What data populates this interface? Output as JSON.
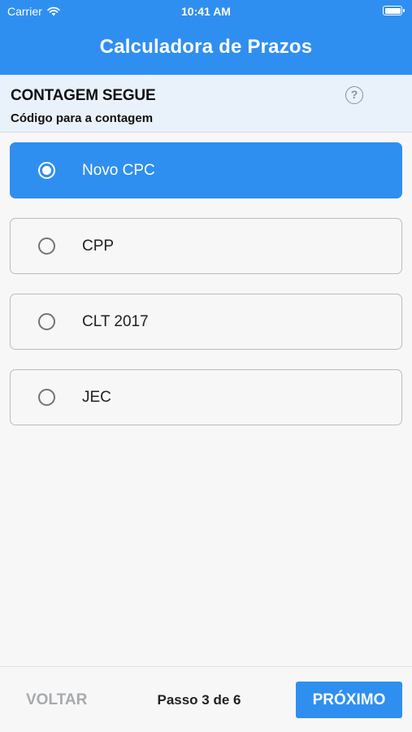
{
  "status_bar": {
    "carrier": "Carrier",
    "time": "10:41 AM"
  },
  "header": {
    "title": "Calculadora de Prazos"
  },
  "section": {
    "title": "CONTAGEM SEGUE",
    "subtitle": "Código para a contagem",
    "help": "?"
  },
  "options": [
    {
      "label": "Novo CPC",
      "selected": true
    },
    {
      "label": "CPP",
      "selected": false
    },
    {
      "label": "CLT 2017",
      "selected": false
    },
    {
      "label": "JEC",
      "selected": false
    }
  ],
  "footer": {
    "back_label": "VOLTAR",
    "step_text": "Passo 3 de 6",
    "next_label": "PRÓXIMO"
  },
  "colors": {
    "accent": "#2f8ff0",
    "header_bg": "#e9f1fa",
    "disabled_text": "#a7aaae"
  }
}
